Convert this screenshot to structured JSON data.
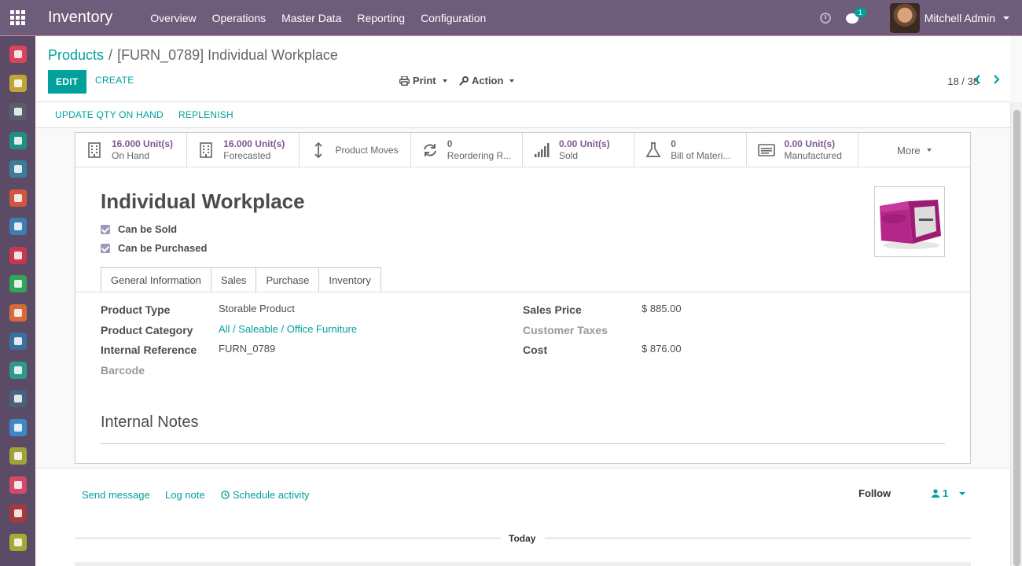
{
  "app": {
    "title": "Inventory",
    "menu": [
      "Overview",
      "Operations",
      "Master Data",
      "Reporting",
      "Configuration"
    ],
    "chat_badge": "1",
    "user": "Mitchell Admin"
  },
  "sidebar": {
    "apps": [
      {
        "icon": "discuss-icon",
        "color": "#d6455d"
      },
      {
        "icon": "calendar-icon",
        "color": "#bfa43a"
      },
      {
        "icon": "notes-icon",
        "color": "#575f6b"
      },
      {
        "icon": "contacts-icon",
        "color": "#1f8f84"
      },
      {
        "icon": "crm-icon",
        "color": "#3c7d99"
      },
      {
        "icon": "sales-icon",
        "color": "#d2563e"
      },
      {
        "icon": "pos-icon",
        "color": "#3e7db3"
      },
      {
        "icon": "inventory-icon",
        "color": "#c9374f"
      },
      {
        "icon": "manufacturing-icon",
        "color": "#32a35a"
      },
      {
        "icon": "invoicing-icon",
        "color": "#d46c3a"
      },
      {
        "icon": "apps-icon",
        "color": "#3a6f9e"
      },
      {
        "icon": "employees-icon",
        "color": "#2f9a8a"
      },
      {
        "icon": "recruitment-icon",
        "color": "#48617d"
      },
      {
        "icon": "attendance-icon",
        "color": "#3f86c6"
      },
      {
        "icon": "expenses-icon",
        "color": "#9ea43a"
      },
      {
        "icon": "dashboards-icon",
        "color": "#d14a66"
      },
      {
        "icon": "website-icon",
        "color": "#a63a3a"
      },
      {
        "icon": "settings-icon",
        "color": "#a8a835"
      }
    ]
  },
  "breadcrumb": {
    "parent": "Products",
    "separator": "/",
    "current": "[FURN_0789] Individual Workplace"
  },
  "toolbar": {
    "edit": "EDIT",
    "create": "CREATE",
    "print": "Print",
    "action": "Action",
    "pager": "18 / 38"
  },
  "statusbar": {
    "update_qty": "UPDATE QTY ON HAND",
    "replenish": "REPLENISH"
  },
  "smart_buttons": [
    {
      "icon": "building-icon",
      "value": "16.000 Unit(s)",
      "label": "On Hand"
    },
    {
      "icon": "building-icon",
      "value": "16.000 Unit(s)",
      "label": "Forecasted"
    },
    {
      "icon": "arrows-vertical-icon",
      "value": "",
      "label": "Product Moves"
    },
    {
      "icon": "refresh-icon",
      "value": "0",
      "label": "Reordering R..."
    },
    {
      "icon": "signal-bars-icon",
      "value": "0.00 Unit(s)",
      "label": "Sold"
    },
    {
      "icon": "flask-icon",
      "value": "0",
      "label": "Bill of Materi..."
    },
    {
      "icon": "list-card-icon",
      "value": "0.00 Unit(s)",
      "label": "Manufactured"
    }
  ],
  "more_button": "More",
  "product": {
    "name": "Individual Workplace",
    "can_be_sold": "Can be Sold",
    "can_be_purchased": "Can be Purchased"
  },
  "tabs": [
    "General Information",
    "Sales",
    "Purchase",
    "Inventory"
  ],
  "general": {
    "product_type_label": "Product Type",
    "product_type": "Storable Product",
    "category_label": "Product Category",
    "category": "All / Saleable / Office Furniture",
    "internal_ref_label": "Internal Reference",
    "internal_ref": "FURN_0789",
    "barcode_label": "Barcode",
    "sales_price_label": "Sales Price",
    "sales_price": "$ 885.00",
    "customer_taxes_label": "Customer Taxes",
    "cost_label": "Cost",
    "cost": "$ 876.00",
    "internal_notes": "Internal Notes"
  },
  "chatter": {
    "send_message": "Send message",
    "log_note": "Log note",
    "schedule_activity": "Schedule activity",
    "follow": "Follow",
    "followers": "1",
    "today": "Today"
  },
  "colors": {
    "brand": "#6e5c7b",
    "accent": "#00a09d",
    "smart_value": "#7c5a91"
  }
}
